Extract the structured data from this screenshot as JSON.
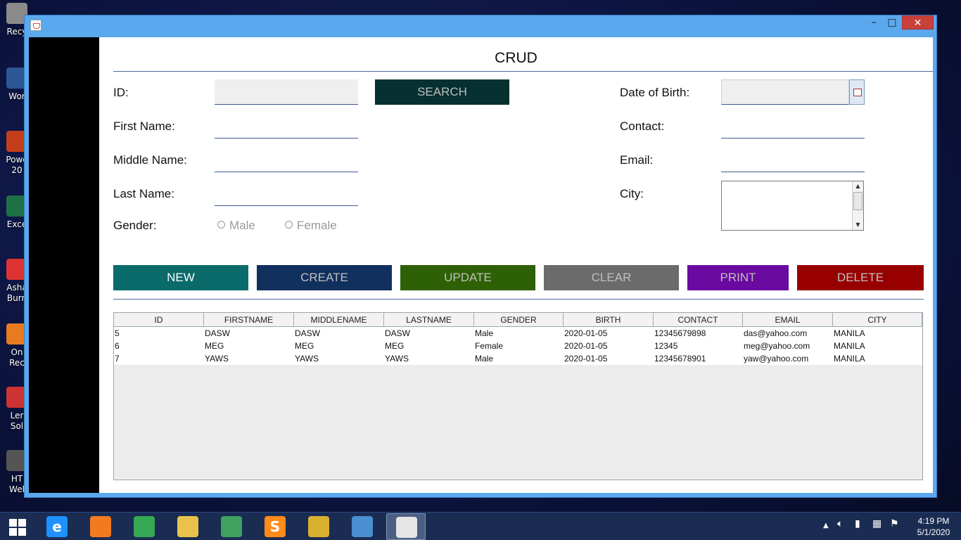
{
  "desktop": {
    "icons": [
      {
        "label": "Recy",
        "color": "#8a8a8a"
      },
      {
        "label": "Wor",
        "color": "#2b5797"
      },
      {
        "label": "Powe",
        "label2": "20",
        "color": "#c43e1c"
      },
      {
        "label": "Exce",
        "color": "#1e7145"
      },
      {
        "label": "Asha",
        "label2": "Burn",
        "color": "#d33"
      },
      {
        "label": "On",
        "label2": "Rec",
        "color": "#e87a1f"
      },
      {
        "label": "Ler",
        "label2": "Sol",
        "color": "#c33"
      },
      {
        "label": "HT",
        "label2": "Wel",
        "color": "#555"
      }
    ]
  },
  "window": {
    "buttons": {
      "minimize": "–",
      "maximize": "□",
      "close": "✕"
    }
  },
  "form": {
    "title": "CRUD",
    "id_label": "ID:",
    "first_name_label": "First Name:",
    "middle_name_label": "Middle Name:",
    "last_name_label": "Last Name:",
    "gender_label": "Gender:",
    "gender_options": [
      "Male",
      "Female"
    ],
    "search_label": "SEARCH",
    "dob_label": "Date of Birth:",
    "contact_label": "Contact:",
    "email_label": "Email:",
    "city_label": "City:"
  },
  "actions": {
    "new": "NEW",
    "create": "CREATE",
    "update": "UPDATE",
    "clear": "CLEAR",
    "print": "PRINT",
    "delete": "DELETE"
  },
  "colors": {
    "search": "#073030",
    "new": "#0b6b6b",
    "create": "#11305e",
    "update": "#2e6005",
    "clear": "#6b6b6b",
    "print": "#6a0aa0",
    "delete": "#980000"
  },
  "table": {
    "columns": [
      "ID",
      "FIRSTNAME",
      "MIDDLENAME",
      "LASTNAME",
      "GENDER",
      "BIRTH",
      "CONTACT",
      "EMAIL",
      "CITY"
    ],
    "rows": [
      [
        "5",
        "DASW",
        "DASW",
        "DASW",
        "Male",
        "2020-01-05",
        "12345679898",
        "das@yahoo.com",
        "MANILA"
      ],
      [
        "6",
        "MEG",
        "MEG",
        "MEG",
        "Female",
        "2020-01-05",
        "12345",
        "meg@yahoo.com",
        "MANILA"
      ],
      [
        "7",
        "YAWS",
        "YAWS",
        "YAWS",
        "Male",
        "2020-01-05",
        "12345678901",
        "yaw@yahoo.com",
        "MANILA"
      ]
    ]
  },
  "taskbar": {
    "apps": [
      {
        "name": "internet-explorer",
        "color": "#1e90ff",
        "glyph": "e"
      },
      {
        "name": "xampp",
        "color": "#f47a20",
        "glyph": ""
      },
      {
        "name": "chrome",
        "color": "#34a853",
        "glyph": ""
      },
      {
        "name": "file-explorer",
        "color": "#e8c24a",
        "glyph": ""
      },
      {
        "name": "atom",
        "color": "#40a060",
        "glyph": ""
      },
      {
        "name": "sublime-text",
        "color": "#ff8c1a",
        "glyph": "S"
      },
      {
        "name": "database-tool",
        "color": "#d8b030",
        "glyph": ""
      },
      {
        "name": "virtualbox",
        "color": "#4a8fd0",
        "glyph": ""
      },
      {
        "name": "java",
        "color": "#e5e5e5",
        "glyph": ""
      }
    ],
    "time": "4:19 PM",
    "date": "5/1/2020"
  }
}
